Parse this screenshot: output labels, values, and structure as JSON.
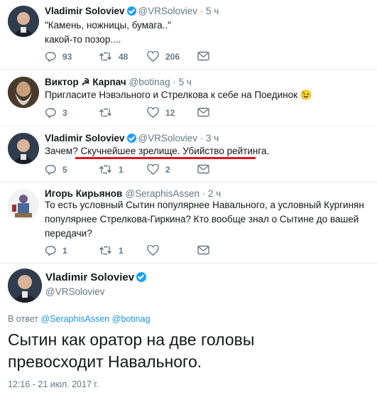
{
  "tweets": [
    {
      "name": "Vladimir Soloviev",
      "handle": "@VRSoloviev",
      "time": "5 ч",
      "verified": true,
      "text_lines": [
        "\"Камень, ножницы, бумага..\"",
        "какой-то позор...."
      ],
      "replies": "93",
      "retweets": "48",
      "likes": "206"
    },
    {
      "name": "Виктор ☭ Карпач",
      "handle": "@botinag",
      "time": "5 ч",
      "verified": false,
      "text_lines": [
        "Пригласите Нэвэльного и Стрелкова к себе на Поединок 😉"
      ],
      "replies": "3",
      "retweets": "",
      "likes": "12"
    },
    {
      "name": "Vladimir Soloviev",
      "handle": "@VRSoloviev",
      "time": "3 ч",
      "verified": true,
      "text_lines": [
        "Зачем? Скучнейшее зрелище. Убийство рейтинга."
      ],
      "replies": "5",
      "retweets": "1",
      "likes": "2"
    },
    {
      "name": "Игорь Кирьянов",
      "handle": "@SeraphisAssen",
      "time": "2 ч",
      "verified": false,
      "text_lines": [
        "То есть условный Сытин популярнее Навального, а условный Кургинян",
        "популярнее Стрелкова-Гиркина? Кто вообще знал о Сытине до вашей",
        "передачи?"
      ],
      "replies": "1",
      "retweets": "1",
      "likes": ""
    }
  ],
  "main_tweet": {
    "name": "Vladimir Soloviev",
    "handle": "@VRSoloviev",
    "verified": true,
    "reply_prefix": "В ответ",
    "reply_to_1": "@SeraphisAssen",
    "reply_to_2": "@botinag",
    "text_line_1": "Сытин как оратор на две головы",
    "text_line_2": "превосходит Навального.",
    "timestamp": "12:16 - 21 июл. 2017 г."
  },
  "colors": {
    "accent": "#1da1f2",
    "link": "#1b95e0",
    "muted": "#657786",
    "highlight_underline": "#e0141e"
  }
}
